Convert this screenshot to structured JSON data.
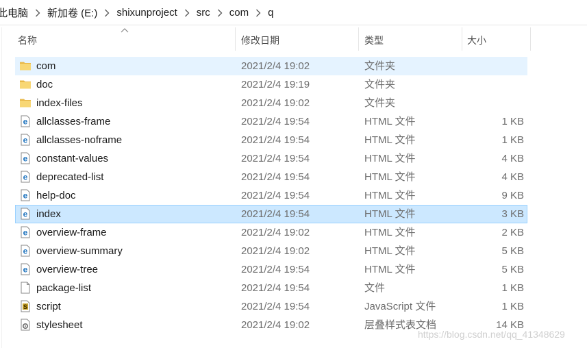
{
  "breadcrumb": [
    "此电脑",
    "新加卷 (E:)",
    "shixunproject",
    "src",
    "com",
    "q"
  ],
  "columns": {
    "name": "名称",
    "date": "修改日期",
    "type": "类型",
    "size": "大小"
  },
  "files": [
    {
      "name": "com",
      "date": "2021/2/4 19:02",
      "type": "文件夹",
      "size": "",
      "icon": "folder-icon",
      "state": "hover"
    },
    {
      "name": "doc",
      "date": "2021/2/4 19:19",
      "type": "文件夹",
      "size": "",
      "icon": "folder-icon",
      "state": ""
    },
    {
      "name": "index-files",
      "date": "2021/2/4 19:02",
      "type": "文件夹",
      "size": "",
      "icon": "folder-icon",
      "state": ""
    },
    {
      "name": "allclasses-frame",
      "date": "2021/2/4 19:54",
      "type": "HTML 文件",
      "size": "1 KB",
      "icon": "html-file-icon",
      "state": ""
    },
    {
      "name": "allclasses-noframe",
      "date": "2021/2/4 19:54",
      "type": "HTML 文件",
      "size": "1 KB",
      "icon": "html-file-icon",
      "state": ""
    },
    {
      "name": "constant-values",
      "date": "2021/2/4 19:54",
      "type": "HTML 文件",
      "size": "4 KB",
      "icon": "html-file-icon",
      "state": ""
    },
    {
      "name": "deprecated-list",
      "date": "2021/2/4 19:54",
      "type": "HTML 文件",
      "size": "4 KB",
      "icon": "html-file-icon",
      "state": ""
    },
    {
      "name": "help-doc",
      "date": "2021/2/4 19:54",
      "type": "HTML 文件",
      "size": "9 KB",
      "icon": "html-file-icon",
      "state": ""
    },
    {
      "name": "index",
      "date": "2021/2/4 19:54",
      "type": "HTML 文件",
      "size": "3 KB",
      "icon": "html-file-icon",
      "state": "selected"
    },
    {
      "name": "overview-frame",
      "date": "2021/2/4 19:02",
      "type": "HTML 文件",
      "size": "2 KB",
      "icon": "html-file-icon",
      "state": ""
    },
    {
      "name": "overview-summary",
      "date": "2021/2/4 19:02",
      "type": "HTML 文件",
      "size": "5 KB",
      "icon": "html-file-icon",
      "state": ""
    },
    {
      "name": "overview-tree",
      "date": "2021/2/4 19:54",
      "type": "HTML 文件",
      "size": "5 KB",
      "icon": "html-file-icon",
      "state": ""
    },
    {
      "name": "package-list",
      "date": "2021/2/4 19:54",
      "type": "文件",
      "size": "1 KB",
      "icon": "blank-file-icon",
      "state": ""
    },
    {
      "name": "script",
      "date": "2021/2/4 19:54",
      "type": "JavaScript 文件",
      "size": "1 KB",
      "icon": "script-file-icon",
      "state": ""
    },
    {
      "name": "stylesheet",
      "date": "2021/2/4 19:02",
      "type": "层叠样式表文档",
      "size": "14 KB",
      "icon": "css-file-icon",
      "state": ""
    }
  ],
  "watermark": "https://blog.csdn.net/qq_41348629",
  "colors": {
    "hover": "#e5f3ff",
    "selected": "#cce8ff",
    "selected_border": "#99d1ff",
    "folder": "#f8d775",
    "html_icon": "#1e73be"
  }
}
